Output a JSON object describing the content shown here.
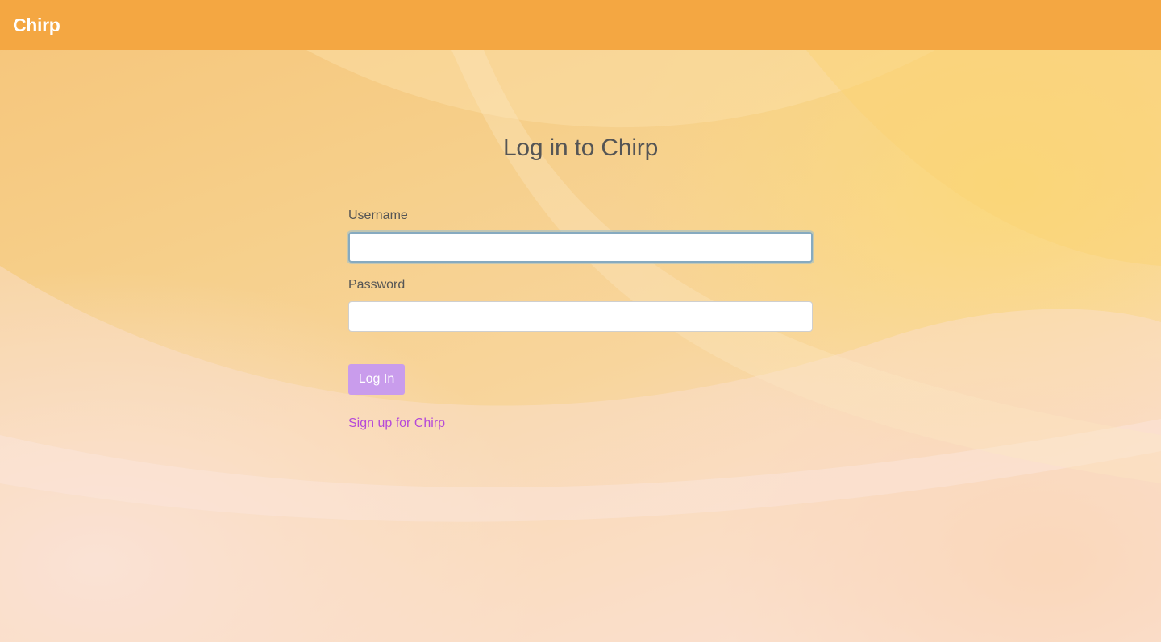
{
  "app": {
    "brand": "Chirp"
  },
  "login": {
    "title": "Log in to Chirp",
    "username_label": "Username",
    "username_value": "",
    "password_label": "Password",
    "password_value": "",
    "submit_label": "Log In",
    "signup_link": "Sign up for Chirp"
  },
  "colors": {
    "navbar": "#f4a742",
    "button": "#c99cec",
    "link": "#b54ad8",
    "text": "#555555"
  }
}
